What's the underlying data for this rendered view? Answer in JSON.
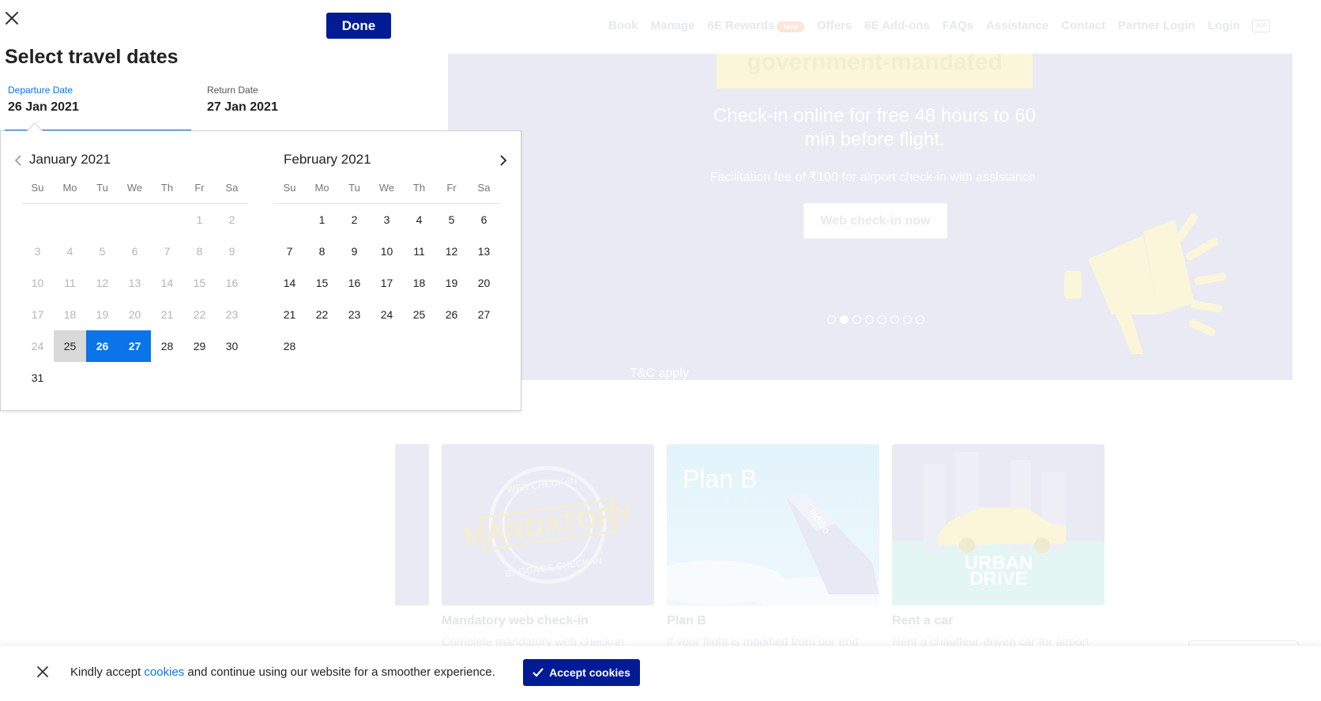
{
  "nav": {
    "items": [
      "Book",
      "Manage",
      "6E Rewards",
      "Offers",
      "6E Add-ons",
      "FAQs",
      "Assistance",
      "Contact",
      "Partner Login",
      "Login"
    ],
    "rewards_badge": "New",
    "lang": "A/A"
  },
  "banner": {
    "yellow_text": "government-mandated",
    "headline": "Check-in online for free 48 hours to 60 min before flight.",
    "subline": "Facilitation fee of ₹100 for airport check-in with assistance.",
    "cta": "Web check-in now",
    "tnc": "T&C apply",
    "slide_count": 8,
    "active_slide": 2
  },
  "cards": [
    {
      "title": "Mandatory web check-in",
      "desc": "Complete mandatory web check-in",
      "image_text": "MANDATORY",
      "ring_top": "WEB CHECK-IN",
      "ring_bottom": "BAGGAGE CHECK-IN"
    },
    {
      "title": "Plan B",
      "desc": "If your flight is modified from our end",
      "image_text": "Plan B",
      "plane_text": "IndiGo"
    },
    {
      "title": "Rent a car",
      "desc": "Rent a chauffeur-driven car for airport",
      "image_text_1": "URBAN",
      "image_text_2": "DRIVE"
    }
  ],
  "picker": {
    "done_label": "Done",
    "title": "Select travel dates",
    "departure_label": "Departure Date",
    "departure_value": "26 Jan 2021",
    "return_label": "Return Date",
    "return_value": "27 Jan 2021",
    "weekdays": [
      "Su",
      "Mo",
      "Tu",
      "We",
      "Th",
      "Fr",
      "Sa"
    ],
    "months": [
      {
        "title": "January 2021",
        "lead_blanks": 5,
        "days": [
          "1",
          "2",
          "3",
          "4",
          "5",
          "6",
          "7",
          "8",
          "9",
          "10",
          "11",
          "12",
          "13",
          "14",
          "15",
          "16",
          "17",
          "18",
          "19",
          "20",
          "21",
          "22",
          "23",
          "24",
          "25",
          "26",
          "27",
          "28",
          "29",
          "30",
          "31"
        ],
        "muted_until": 24,
        "today": 25,
        "selected": [
          26,
          27
        ]
      },
      {
        "title": "February 2021",
        "lead_blanks": 1,
        "days": [
          "1",
          "2",
          "3",
          "4",
          "5",
          "6",
          "7",
          "8",
          "9",
          "10",
          "11",
          "12",
          "13",
          "14",
          "15",
          "16",
          "17",
          "18",
          "19",
          "20",
          "21",
          "22",
          "23",
          "24",
          "25",
          "26",
          "27",
          "28"
        ],
        "muted_until": 0,
        "today": 0,
        "selected": []
      }
    ]
  },
  "cookie": {
    "text_before": "Kindly accept ",
    "link": "cookies",
    "text_after": " and continue using our website for a smoother experience.",
    "accept_label": "Accept cookies"
  },
  "colors": {
    "brand_navy": "#001b94",
    "accent_blue": "#0a74e8",
    "today_gray": "#d9d9d9",
    "banner_bg": "#e9eaf4"
  }
}
